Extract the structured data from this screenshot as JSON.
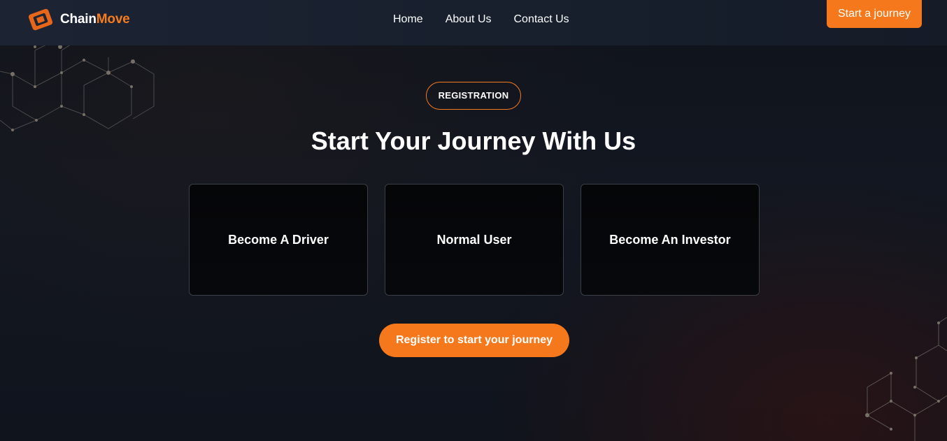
{
  "brand": {
    "name_part1": "Chain",
    "name_part2": "Move",
    "accent_color": "#f57b20"
  },
  "nav": {
    "items": [
      {
        "label": "Home"
      },
      {
        "label": "About Us"
      },
      {
        "label": "Contact Us"
      }
    ],
    "cta_label": "Start a journey"
  },
  "hero": {
    "badge": "REGISTRATION",
    "title": "Start Your Journey With Us",
    "options": [
      {
        "label": "Become A Driver"
      },
      {
        "label": "Normal User"
      },
      {
        "label": "Become An Investor"
      }
    ],
    "register_label": "Register to start your journey"
  },
  "icons": {
    "logo": "chainmove-logo-icon",
    "decor_top_left": "network-hexagon-decoration",
    "decor_bottom_right": "network-hexagon-decoration"
  }
}
